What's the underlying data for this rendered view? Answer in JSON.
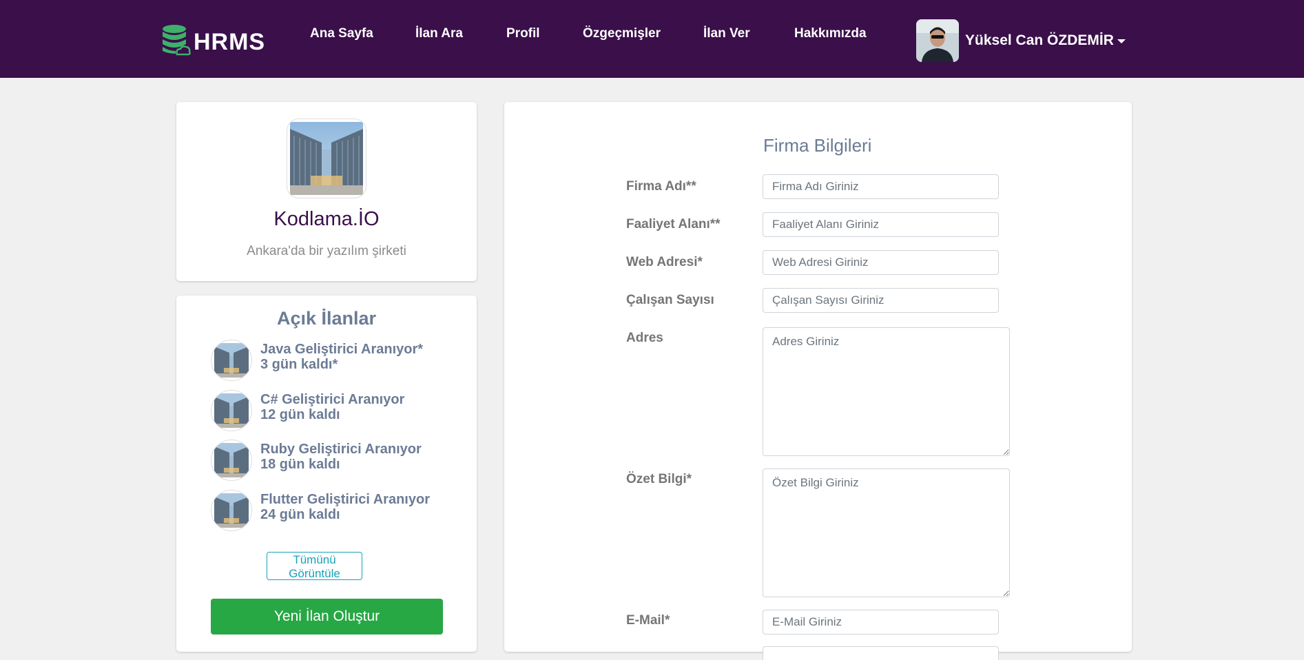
{
  "brand": {
    "name": "HRMS",
    "accent": "#3a0f4a",
    "logo_icon": "database-cloud-icon",
    "logo_color": "#3fb06b"
  },
  "nav": {
    "items": [
      {
        "label": "Ana Sayfa"
      },
      {
        "label": "İlan Ara"
      },
      {
        "label": "Profil"
      },
      {
        "label": "Özgeçmişler"
      },
      {
        "label": "İlan Ver"
      },
      {
        "label": "Hakkımızda"
      }
    ],
    "user": {
      "name": "Yüksel Can ÖZDEMİR",
      "avatar_icon": "user-avatar"
    }
  },
  "company": {
    "name": "Kodlama.İO",
    "description": "Ankara'da bir yazılım şirketi",
    "logo_icon": "office-building-photo"
  },
  "jobs": {
    "title": "Açık İlanlar",
    "items": [
      {
        "title": "Java Geliştirici Aranıyor*",
        "remaining": "3 gün kaldı*"
      },
      {
        "title": "C# Geliştirici Aranıyor",
        "remaining": "12 gün kaldı"
      },
      {
        "title": "Ruby Geliştirici Aranıyor",
        "remaining": "18 gün kaldı"
      },
      {
        "title": "Flutter Geliştirici Aranıyor",
        "remaining": "24 gün kaldı"
      }
    ],
    "view_all_label": "Tümünü Görüntüle",
    "new_job_label": "Yeni İlan Oluştur",
    "new_job_color": "#28a745"
  },
  "form": {
    "title": "Firma Bilgileri",
    "fields": [
      {
        "label": "Firma Adı**",
        "placeholder": "Firma Adı Giriniz",
        "value": ""
      },
      {
        "label": "Faaliyet Alanı**",
        "placeholder": "Faaliyet Alanı Giriniz",
        "value": ""
      },
      {
        "label": "Web Adresi*",
        "placeholder": "Web Adresi Giriniz",
        "value": ""
      },
      {
        "label": "Çalışan Sayısı",
        "placeholder": "Çalışan Sayısı Giriniz",
        "value": ""
      },
      {
        "label": "Adres",
        "placeholder": "Adres Giriniz",
        "value": ""
      },
      {
        "label": "Özet Bilgi*",
        "placeholder": "Özet Bilgi Giriniz",
        "value": ""
      },
      {
        "label": "E-Mail*",
        "placeholder": "E-Mail Giriniz",
        "value": ""
      }
    ]
  }
}
